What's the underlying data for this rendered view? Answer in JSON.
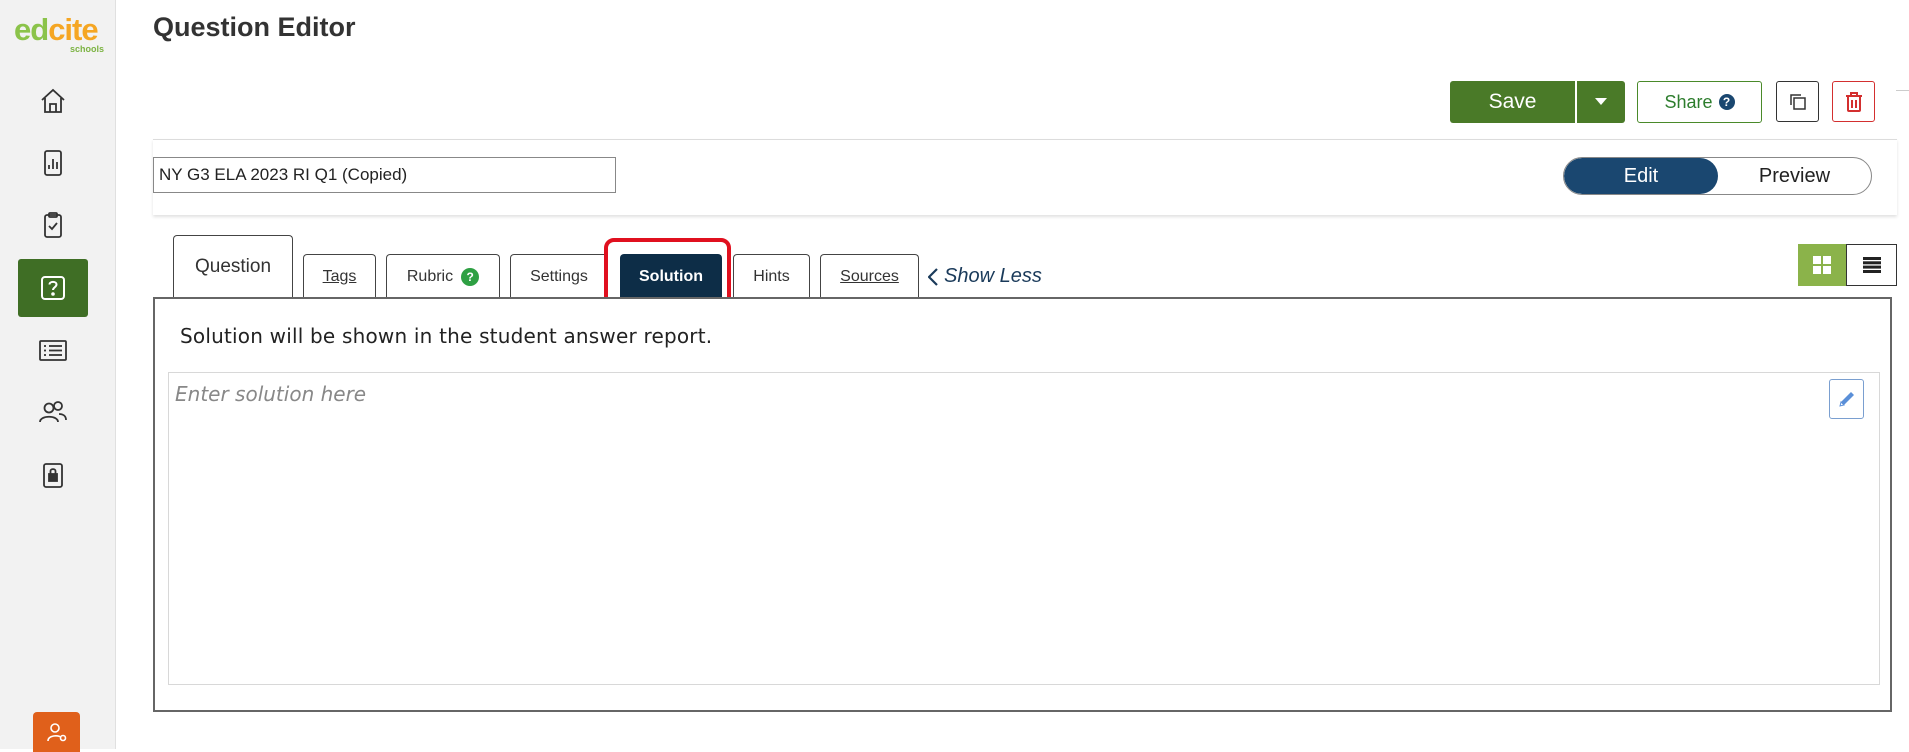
{
  "app": {
    "logo_main_ed": "ed",
    "logo_main_cite": "cite",
    "logo_sub": "schools",
    "colors": {
      "primary_green": "#4a7a28",
      "navy": "#1a4770",
      "highlight_red": "#e0101f",
      "user_orange": "#e0601b"
    }
  },
  "sidebar": {
    "items": [
      {
        "name": "home",
        "icon": "home-icon"
      },
      {
        "name": "reports",
        "icon": "bar-chart-icon"
      },
      {
        "name": "assignments",
        "icon": "clipboard-check-icon"
      },
      {
        "name": "questions",
        "icon": "question-icon",
        "active": true
      },
      {
        "name": "lists",
        "icon": "list-icon"
      },
      {
        "name": "people",
        "icon": "users-icon"
      },
      {
        "name": "security",
        "icon": "lock-icon"
      }
    ],
    "user_icon": "user-settings-icon"
  },
  "header": {
    "title": "Question Editor",
    "save_label": "Save",
    "share_label": "Share",
    "share_help": "?"
  },
  "question": {
    "title_value": "NY G3 ELA 2023 RI Q1 (Copied)"
  },
  "mode_toggle": {
    "edit_label": "Edit",
    "preview_label": "Preview",
    "selected": "Edit"
  },
  "tabs": {
    "question": "Question",
    "tags": "Tags",
    "rubric": "Rubric",
    "rubric_help": "?",
    "settings": "Settings",
    "solution": "Solution",
    "hints": "Hints",
    "sources": "Sources",
    "show_less": "Show Less",
    "active": "Solution"
  },
  "solution_panel": {
    "note": "Solution will be shown in the student answer report.",
    "placeholder": "Enter solution here"
  }
}
